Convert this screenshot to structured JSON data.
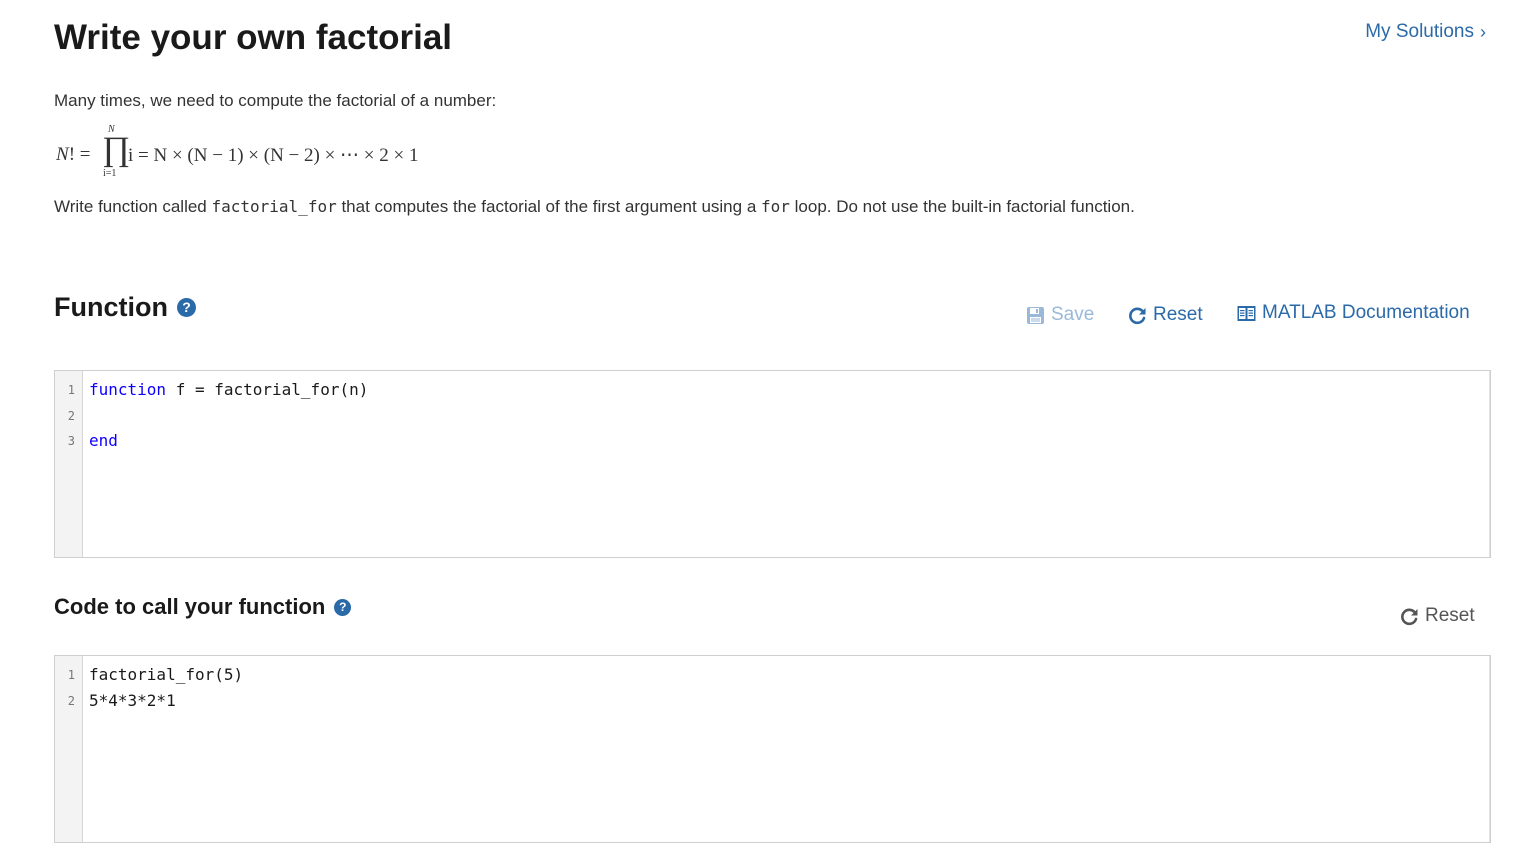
{
  "header": {
    "title": "Write your own factorial",
    "my_solutions": "My Solutions"
  },
  "problem": {
    "intro": "Many times, we need to compute the factorial of a number:",
    "formula": {
      "lhs": "N! =",
      "product_symbol": "∏",
      "upper": "N",
      "lower": "i=1",
      "rhs": "i = N × (N − 1) × (N − 2) × ⋯ × 2 × 1"
    },
    "description": {
      "part1": "Write function called ",
      "code1": "factorial_for",
      "part2": " that computes the factorial of the first argument using a ",
      "code2": "for",
      "part3": " loop.  Do not use the built-in factorial function."
    }
  },
  "function_section": {
    "title": "Function",
    "save_label": "Save",
    "reset_label": "Reset",
    "docs_label": "MATLAB Documentation",
    "line_numbers": [
      "1",
      "2",
      "3"
    ],
    "lines": [
      {
        "keyword": "function",
        "rest": " f = factorial_for(n)"
      },
      {
        "keyword": "",
        "rest": ""
      },
      {
        "keyword": "end",
        "rest": ""
      }
    ]
  },
  "call_section": {
    "title": "Code to call your function",
    "reset_label": "Reset",
    "line_numbers": [
      "1",
      "2"
    ],
    "lines": [
      "factorial_for(5)",
      "5*4*3*2*1"
    ]
  },
  "colors": {
    "link": "#2b6aa8",
    "save_disabled": "#9ab9d8",
    "keyword": "#0e00ff"
  }
}
